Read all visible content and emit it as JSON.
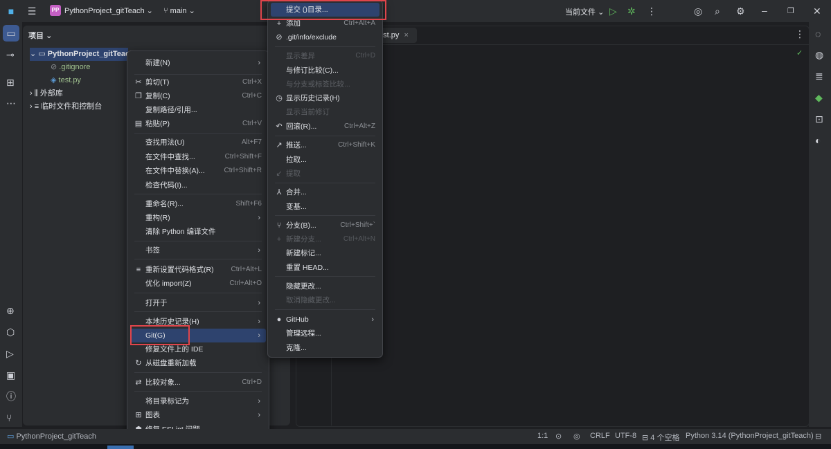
{
  "titlebar": {
    "project_badge": "PP",
    "project_name": "PythonProject_gitTeach",
    "branch": "main",
    "run_config": "当前文件"
  },
  "project_panel": {
    "title": "项目",
    "tree": {
      "root": "PythonProject_gitTeach",
      "files": [
        ".gitignore",
        "test.py"
      ],
      "external_libraries": "外部库",
      "scratches": "临时文件和控制台"
    }
  },
  "editor": {
    "tab_label": "test.py"
  },
  "context_menu": {
    "items": [
      {
        "label": "新建(N)",
        "submenu": true
      },
      {
        "label": "剪切(T)",
        "shortcut": "Ctrl+X",
        "icon": "cut-icon"
      },
      {
        "label": "复制(C)",
        "shortcut": "Ctrl+C",
        "icon": "copy-icon"
      },
      {
        "label": "复制路径/引用..."
      },
      {
        "label": "粘贴(P)",
        "shortcut": "Ctrl+V",
        "icon": "paste-icon"
      },
      {
        "label": "查找用法(U)",
        "shortcut": "Alt+F7"
      },
      {
        "label": "在文件中查找...",
        "shortcut": "Ctrl+Shift+F"
      },
      {
        "label": "在文件中替换(A)...",
        "shortcut": "Ctrl+Shift+R"
      },
      {
        "label": "检查代码(I)..."
      },
      {
        "label": "重命名(R)...",
        "shortcut": "Shift+F6"
      },
      {
        "label": "重构(R)",
        "submenu": true
      },
      {
        "label": "清除 Python 编译文件"
      },
      {
        "label": "书签",
        "submenu": true
      },
      {
        "label": "重新设置代码格式(R)",
        "shortcut": "Ctrl+Alt+L",
        "icon": "reformat-icon"
      },
      {
        "label": "优化 import(Z)",
        "shortcut": "Ctrl+Alt+O"
      },
      {
        "label": "打开于",
        "submenu": true
      },
      {
        "label": "本地历史记录(H)",
        "submenu": true
      },
      {
        "label": "Git(G)",
        "submenu": true,
        "selected": true
      },
      {
        "label": "修复文件上的 IDE"
      },
      {
        "label": "从磁盘重新加载",
        "icon": "reload-icon"
      },
      {
        "label": "比较对象...",
        "shortcut": "Ctrl+D",
        "icon": "compare-icon"
      },
      {
        "label": "将目录标记为",
        "submenu": true
      },
      {
        "label": "图表",
        "submenu": true,
        "icon": "diagram-icon"
      },
      {
        "label": "修复 ESLint 问题",
        "icon": "eslint-icon"
      }
    ]
  },
  "git_submenu": {
    "items": [
      {
        "label": "提交 ()目录...",
        "selected": true
      },
      {
        "label": "添加",
        "shortcut": "Ctrl+Alt+A",
        "icon": "plus-icon"
      },
      {
        "label": ".git/info/exclude",
        "icon": "ignore-icon"
      },
      {
        "label": "显示差异",
        "shortcut": "Ctrl+D",
        "disabled": true
      },
      {
        "label": "与修订比较(C)..."
      },
      {
        "label": "与分支或标签比较...",
        "disabled": true
      },
      {
        "label": "显示历史记录(H)",
        "icon": "history-icon"
      },
      {
        "label": "显示当前修订",
        "disabled": true
      },
      {
        "label": "回滚(R)...",
        "shortcut": "Ctrl+Alt+Z",
        "icon": "rollback-icon"
      },
      {
        "label": "推送...",
        "shortcut": "Ctrl+Shift+K",
        "icon": "push-icon"
      },
      {
        "label": "拉取..."
      },
      {
        "label": "提取",
        "disabled": true,
        "icon": "fetch-icon"
      },
      {
        "label": "合并...",
        "icon": "merge-icon"
      },
      {
        "label": "变基..."
      },
      {
        "label": "分支(B)...",
        "shortcut": "Ctrl+Shift+`",
        "icon": "branch-icon"
      },
      {
        "label": "新建分支...",
        "shortcut": "Ctrl+Alt+N",
        "disabled": true,
        "icon": "plus-icon"
      },
      {
        "label": "新建标记..."
      },
      {
        "label": "重置 HEAD..."
      },
      {
        "label": "隐藏更改..."
      },
      {
        "label": "取消隐藏更改...",
        "disabled": true
      },
      {
        "label": "GitHub",
        "submenu": true,
        "icon": "github-icon"
      },
      {
        "label": "管理远程..."
      },
      {
        "label": "克隆..."
      }
    ]
  },
  "statusbar": {
    "breadcrumb": "PythonProject_gitTeach",
    "position": "1:1",
    "line_ending": "CRLF",
    "encoding": "UTF-8",
    "indent": "4 个空格",
    "interpreter": "Python 3.14 (PythonProject_gitTeach)"
  }
}
